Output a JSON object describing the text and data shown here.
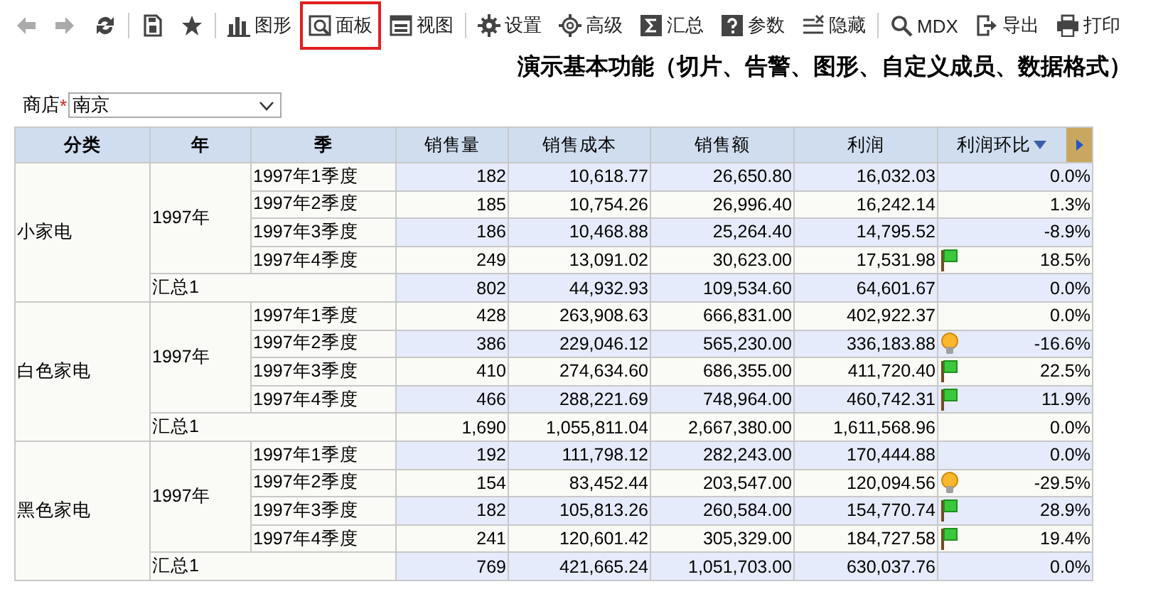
{
  "toolbar": [
    {
      "kind": "back",
      "disabled": true,
      "selected": false
    },
    {
      "kind": "forward",
      "disabled": true,
      "selected": false
    },
    {
      "kind": "refresh",
      "disabled": false,
      "selected": false
    },
    {
      "kind": "save",
      "disabled": false,
      "selected": false
    },
    {
      "kind": "star",
      "disabled": false,
      "selected": false
    },
    {
      "kind": "chart",
      "label": "图形",
      "disabled": false,
      "selected": false
    },
    {
      "kind": "panel",
      "label": "面板",
      "disabled": false,
      "selected": true
    },
    {
      "kind": "view",
      "label": "视图",
      "disabled": false,
      "selected": false
    },
    {
      "kind": "gear",
      "label": "设置",
      "disabled": false,
      "selected": false
    },
    {
      "kind": "gear-outline",
      "label": "高级",
      "disabled": false,
      "selected": false
    },
    {
      "kind": "sigma",
      "label": "汇总",
      "disabled": false,
      "selected": false
    },
    {
      "kind": "question",
      "label": "参数",
      "disabled": false,
      "selected": false
    },
    {
      "kind": "hide",
      "label": "隐藏",
      "disabled": false,
      "selected": false
    },
    {
      "kind": "search",
      "label": "MDX",
      "disabled": false,
      "selected": false
    },
    {
      "kind": "export",
      "label": "导出",
      "disabled": false,
      "selected": false
    },
    {
      "kind": "print",
      "label": "打印",
      "disabled": false,
      "selected": false
    }
  ],
  "title": "演示基本功能（切片、告警、图形、自定义成员、数据格式）",
  "filter": {
    "label": "商店",
    "required_mark": "*",
    "value": "南京"
  },
  "table": {
    "columns": [
      "分类",
      "年",
      "季",
      "销售量",
      "销售成本",
      "销售额",
      "利润",
      "利润环比"
    ],
    "groups": [
      {
        "category": "小家电",
        "year": "1997年",
        "rows": [
          {
            "quarter": "1997年1季度",
            "values": [
              "182",
              "10,618.77",
              "26,650.80",
              "16,032.03"
            ],
            "ratio": "0.0%"
          },
          {
            "quarter": "1997年2季度",
            "values": [
              "185",
              "10,754.26",
              "26,996.40",
              "16,242.14"
            ],
            "ratio": "1.3%"
          },
          {
            "quarter": "1997年3季度",
            "values": [
              "186",
              "10,468.88",
              "25,264.40",
              "14,795.52"
            ],
            "ratio": "-8.9%"
          },
          {
            "quarter": "1997年4季度",
            "values": [
              "249",
              "13,091.02",
              "30,623.00",
              "17,531.98"
            ],
            "kind": "flag",
            "ratio": "18.5%"
          }
        ],
        "total": {
          "label": "汇总1",
          "values": [
            "802",
            "44,932.93",
            "109,534.60",
            "64,601.67"
          ],
          "ratio": "0.0%"
        }
      },
      {
        "category": "白色家电",
        "year": "1997年",
        "rows": [
          {
            "quarter": "1997年1季度",
            "values": [
              "428",
              "263,908.63",
              "666,831.00",
              "402,922.37"
            ],
            "ratio": "0.0%"
          },
          {
            "quarter": "1997年2季度",
            "values": [
              "386",
              "229,046.12",
              "565,230.00",
              "336,183.88"
            ],
            "kind": "bulb",
            "ratio": "-16.6%"
          },
          {
            "quarter": "1997年3季度",
            "values": [
              "410",
              "274,634.60",
              "686,355.00",
              "411,720.40"
            ],
            "kind": "flag",
            "ratio": "22.5%"
          },
          {
            "quarter": "1997年4季度",
            "values": [
              "466",
              "288,221.69",
              "748,964.00",
              "460,742.31"
            ],
            "kind": "flag",
            "ratio": "11.9%"
          }
        ],
        "total": {
          "label": "汇总1",
          "values": [
            "1,690",
            "1,055,811.04",
            "2,667,380.00",
            "1,611,568.96"
          ],
          "ratio": "0.0%"
        }
      },
      {
        "category": "黑色家电",
        "year": "1997年",
        "rows": [
          {
            "quarter": "1997年1季度",
            "values": [
              "192",
              "111,798.12",
              "282,243.00",
              "170,444.88"
            ],
            "ratio": "0.0%"
          },
          {
            "quarter": "1997年2季度",
            "values": [
              "154",
              "83,452.44",
              "203,547.00",
              "120,094.56"
            ],
            "kind": "bulb",
            "ratio": "-29.5%"
          },
          {
            "quarter": "1997年3季度",
            "values": [
              "182",
              "105,813.26",
              "260,584.00",
              "154,770.74"
            ],
            "kind": "flag",
            "ratio": "28.9%"
          },
          {
            "quarter": "1997年4季度",
            "values": [
              "241",
              "120,601.42",
              "305,329.00",
              "184,727.58"
            ],
            "kind": "flag",
            "ratio": "19.4%"
          }
        ],
        "total": {
          "label": "汇总1",
          "values": [
            "769",
            "421,665.24",
            "1,051,703.00",
            "630,037.76"
          ],
          "ratio": "0.0%"
        }
      }
    ]
  }
}
